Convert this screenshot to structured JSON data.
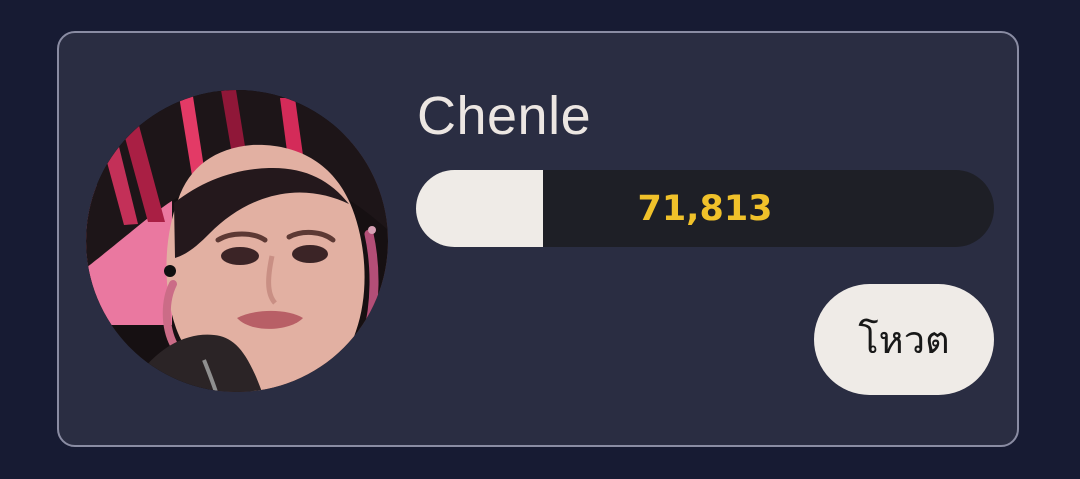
{
  "card": {
    "name": "Chenle",
    "vote_count": "71,813",
    "vote_progress": 0.22,
    "vote_button_label": "โหวต"
  },
  "colors": {
    "background": "#171b33",
    "card_bg": "#2a2d42",
    "card_border": "#8a8ca3",
    "count_text": "#f0c12a",
    "track": "#1e1f26",
    "fill": "#efebe7",
    "button_bg": "#efebe7"
  }
}
